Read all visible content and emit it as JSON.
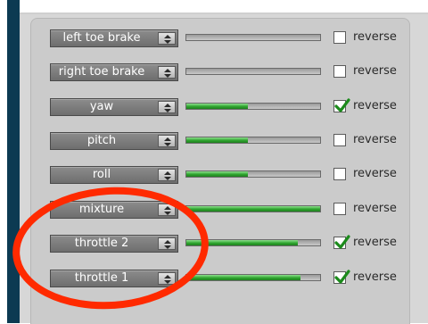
{
  "rows": [
    {
      "label": "left toe brake",
      "value": 0,
      "reverse": false
    },
    {
      "label": "right toe brake",
      "value": 0,
      "reverse": false
    },
    {
      "label": "yaw",
      "value": 0.46,
      "reverse": true
    },
    {
      "label": "pitch",
      "value": 0.46,
      "reverse": false
    },
    {
      "label": "roll",
      "value": 0.46,
      "reverse": false
    },
    {
      "label": "mixture",
      "value": 1.0,
      "reverse": false
    },
    {
      "label": "throttle 2",
      "value": 0.83,
      "reverse": true
    },
    {
      "label": "throttle 1",
      "value": 0.85,
      "reverse": true
    }
  ],
  "reverse_label": "reverse",
  "colors": {
    "fill": "#2fa52f",
    "check": "#1b8a1b",
    "highlight": "#ff2a00"
  },
  "icons": {
    "arrow": "updown-arrow-icon",
    "check": "checkmark-icon"
  }
}
